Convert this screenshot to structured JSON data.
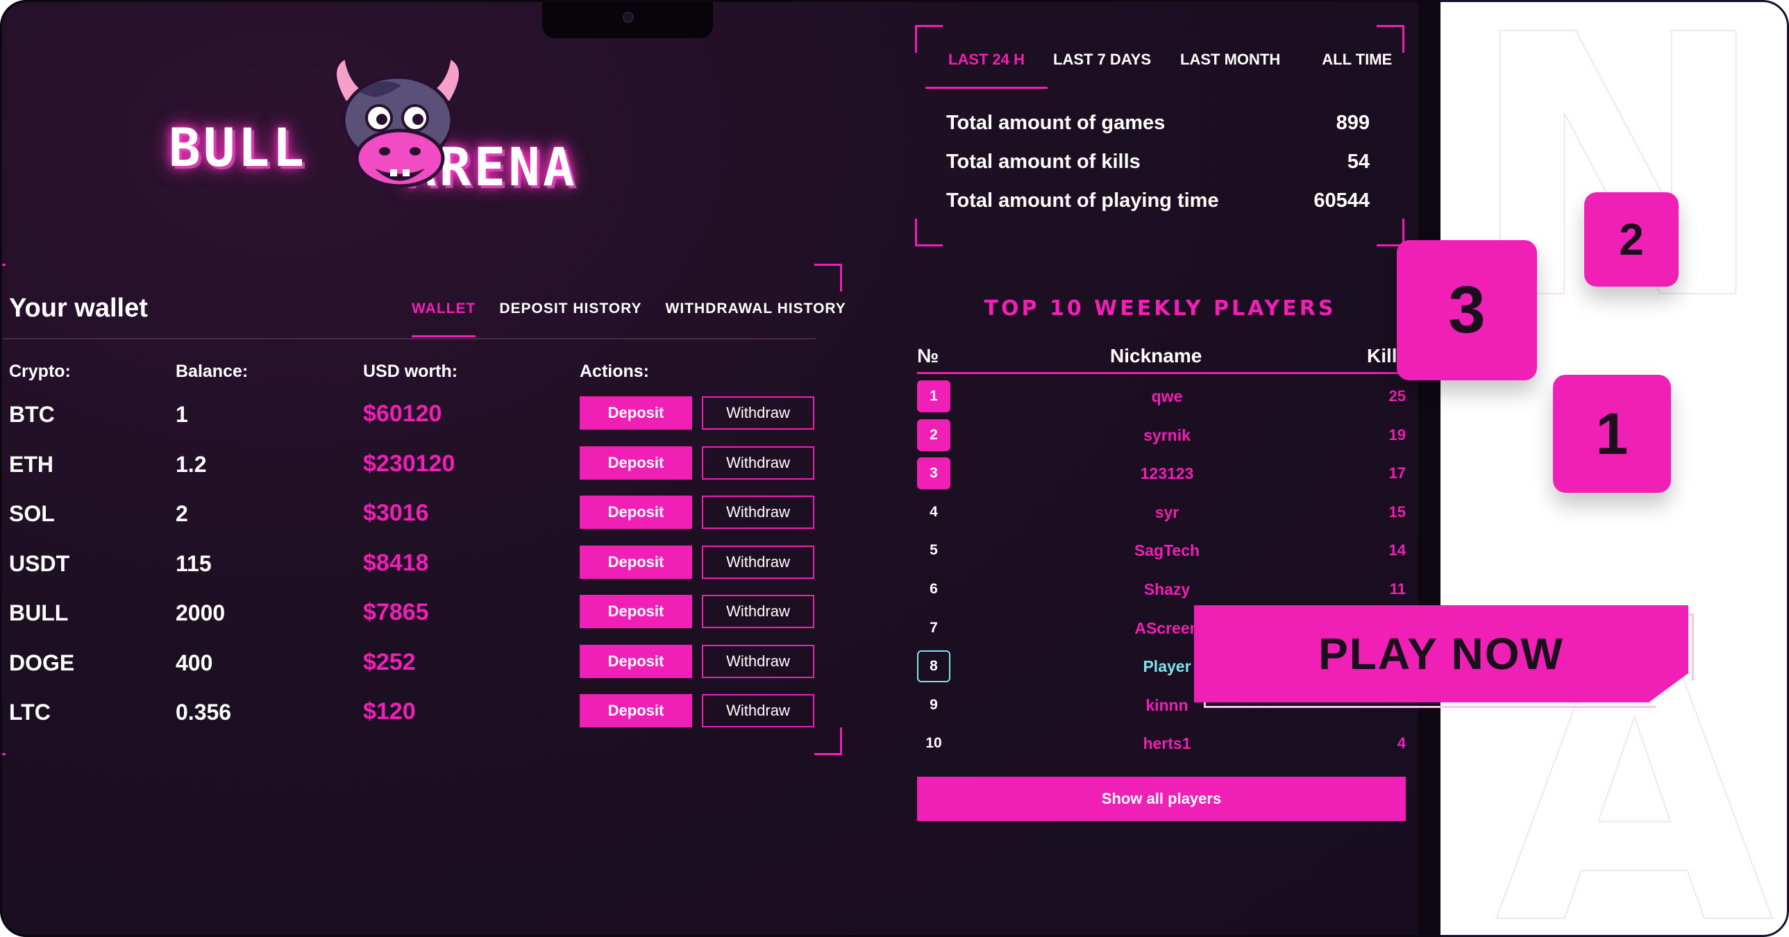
{
  "brand": {
    "logo_left": "BULL",
    "logo_right": "ARENA"
  },
  "colors": {
    "accent": "#f01fb6",
    "highlight": "#7fe3ec",
    "background": "#1d0f22"
  },
  "wallet": {
    "title": "Your wallet",
    "tabs": [
      {
        "label": "WALLET",
        "active": true
      },
      {
        "label": "DEPOSIT HISTORY",
        "active": false
      },
      {
        "label": "WITHDRAWAL HISTORY",
        "active": false
      }
    ],
    "columns": {
      "crypto": "Crypto:",
      "balance": "Balance:",
      "usd": "USD worth:",
      "actions": "Actions:"
    },
    "deposit_label": "Deposit",
    "withdraw_label": "Withdraw",
    "rows": [
      {
        "crypto": "BTC",
        "balance": "1",
        "usd": "$60120"
      },
      {
        "crypto": "ETH",
        "balance": "1.2",
        "usd": "$230120"
      },
      {
        "crypto": "SOL",
        "balance": "2",
        "usd": "$3016"
      },
      {
        "crypto": "USDT",
        "balance": "115",
        "usd": "$8418"
      },
      {
        "crypto": "BULL",
        "balance": "2000",
        "usd": "$7865"
      },
      {
        "crypto": "DOGE",
        "balance": "400",
        "usd": "$252"
      },
      {
        "crypto": "LTC",
        "balance": "0.356",
        "usd": "$120"
      }
    ]
  },
  "stats": {
    "tabs": [
      {
        "label": "LAST 24 H",
        "active": true
      },
      {
        "label": "LAST 7 DAYS",
        "active": false
      },
      {
        "label": "LAST MONTH",
        "active": false
      },
      {
        "label": "ALL TIME",
        "active": false
      }
    ],
    "lines": [
      {
        "label": "Total amount of games",
        "value": "899"
      },
      {
        "label": "Total amount of kills",
        "value": "54"
      },
      {
        "label": "Total amount of playing time",
        "value": "60544"
      }
    ]
  },
  "leaderboard": {
    "title": "TOP 10 WEEKLY PLAYERS",
    "headers": {
      "rank": "№",
      "nickname": "Nickname",
      "kills": "Kills"
    },
    "rows": [
      {
        "rank": "1",
        "nickname": "qwe",
        "kills": "25",
        "style": "top"
      },
      {
        "rank": "2",
        "nickname": "syrnik",
        "kills": "19",
        "style": "top"
      },
      {
        "rank": "3",
        "nickname": "123123",
        "kills": "17",
        "style": "top"
      },
      {
        "rank": "4",
        "nickname": "syr",
        "kills": "15",
        "style": ""
      },
      {
        "rank": "5",
        "nickname": "SagTech",
        "kills": "14",
        "style": ""
      },
      {
        "rank": "6",
        "nickname": "Shazy",
        "kills": "11",
        "style": ""
      },
      {
        "rank": "7",
        "nickname": "AScreen",
        "kills": "",
        "style": ""
      },
      {
        "rank": "8",
        "nickname": "Player",
        "kills": "",
        "style": "me"
      },
      {
        "rank": "9",
        "nickname": "kinnn",
        "kills": "",
        "style": ""
      },
      {
        "rank": "10",
        "nickname": "herts1",
        "kills": "4",
        "style": ""
      }
    ],
    "show_all_label": "Show all players"
  },
  "promo": {
    "tiles": [
      "3",
      "2",
      "1"
    ],
    "play_now": "PLAY NOW"
  }
}
